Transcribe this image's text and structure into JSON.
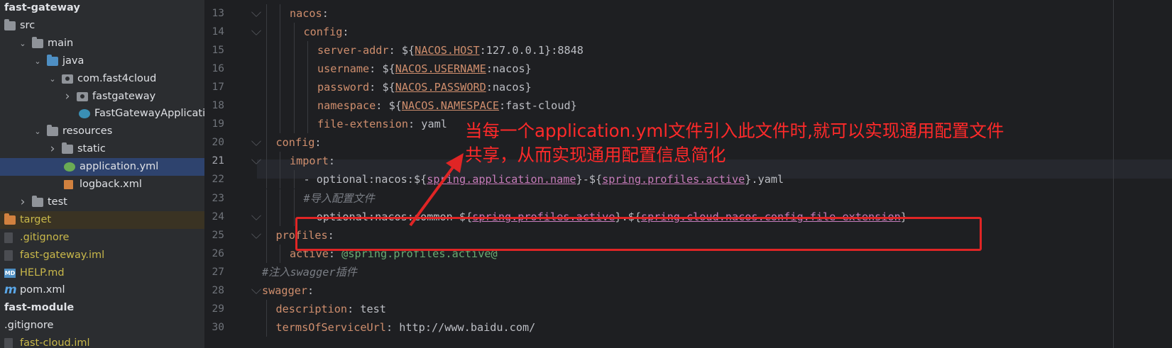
{
  "project_tree": {
    "items": [
      {
        "label": "fast-gateway",
        "depth": 0,
        "kind": "bold"
      },
      {
        "label": "src",
        "depth": 0,
        "kind": "folder"
      },
      {
        "label": "main",
        "depth": 1,
        "kind": "folder",
        "chevron": "down"
      },
      {
        "label": "java",
        "depth": 2,
        "kind": "folder-blue",
        "chevron": "down"
      },
      {
        "label": "com.fast4cloud",
        "depth": 3,
        "kind": "package",
        "chevron": "down"
      },
      {
        "label": "fastgateway",
        "depth": 4,
        "kind": "package",
        "chevron": "right"
      },
      {
        "label": "FastGatewayApplication",
        "depth": 5,
        "kind": "class"
      },
      {
        "label": "resources",
        "depth": 2,
        "kind": "folder-res",
        "chevron": "down"
      },
      {
        "label": "static",
        "depth": 3,
        "kind": "folder",
        "chevron": "right"
      },
      {
        "label": "application.yml",
        "depth": 4,
        "kind": "yml",
        "selected": true
      },
      {
        "label": "logback.xml",
        "depth": 4,
        "kind": "xml"
      },
      {
        "label": "test",
        "depth": 1,
        "kind": "folder",
        "chevron": "right"
      },
      {
        "label": "target",
        "depth": 0,
        "kind": "folder-orange",
        "highlight": true
      },
      {
        "label": ".gitignore",
        "depth": 0,
        "kind": "file-yellow"
      },
      {
        "label": "fast-gateway.iml",
        "depth": 0,
        "kind": "file-yellow"
      },
      {
        "label": "HELP.md",
        "depth": 0,
        "kind": "md"
      },
      {
        "label": "pom.xml",
        "depth": 0,
        "kind": "maven"
      },
      {
        "label": "fast-module",
        "depth": 0,
        "kind": "bold"
      },
      {
        "label": ".gitignore",
        "depth": 0,
        "kind": "plain"
      },
      {
        "label": "fast-cloud.iml",
        "depth": 0,
        "kind": "file-yellow"
      }
    ]
  },
  "editor": {
    "current_line": "21",
    "lines": [
      {
        "n": "13",
        "indent": 2,
        "parts": [
          [
            "k",
            "nacos"
          ],
          [
            "p",
            ":"
          ]
        ]
      },
      {
        "n": "14",
        "indent": 3,
        "parts": [
          [
            "k",
            "config"
          ],
          [
            "p",
            ":"
          ]
        ]
      },
      {
        "n": "15",
        "indent": 4,
        "parts": [
          [
            "k",
            "server-addr"
          ],
          [
            "p",
            ": ${"
          ],
          [
            "u",
            "NACOS.HOST"
          ],
          [
            "p",
            ":127.0.0.1}:8848"
          ]
        ]
      },
      {
        "n": "16",
        "indent": 4,
        "parts": [
          [
            "k",
            "username"
          ],
          [
            "p",
            ": ${"
          ],
          [
            "u",
            "NACOS.USERNAME"
          ],
          [
            "p",
            ":nacos}"
          ]
        ]
      },
      {
        "n": "17",
        "indent": 4,
        "parts": [
          [
            "k",
            "password"
          ],
          [
            "p",
            ": ${"
          ],
          [
            "u",
            "NACOS.PASSWORD"
          ],
          [
            "p",
            ":nacos}"
          ]
        ]
      },
      {
        "n": "18",
        "indent": 4,
        "parts": [
          [
            "k",
            "namespace"
          ],
          [
            "p",
            ": ${"
          ],
          [
            "u",
            "NACOS.NAMESPACE"
          ],
          [
            "p",
            ":fast-cloud}"
          ]
        ]
      },
      {
        "n": "19",
        "indent": 4,
        "parts": [
          [
            "k",
            "file-extension"
          ],
          [
            "p",
            ": yaml"
          ]
        ]
      },
      {
        "n": "20",
        "indent": 1,
        "parts": [
          [
            "k",
            "config"
          ],
          [
            "p",
            ":"
          ]
        ]
      },
      {
        "n": "21",
        "indent": 2,
        "parts": [
          [
            "k",
            "import"
          ],
          [
            "p",
            ":"
          ]
        ]
      },
      {
        "n": "22",
        "indent": 3,
        "parts": [
          [
            "p",
            "- optional:nacos:${"
          ],
          [
            "v",
            "spring.application.name"
          ],
          [
            "p",
            "}-${"
          ],
          [
            "v",
            "spring.profiles.active"
          ],
          [
            "p",
            "}.yaml"
          ]
        ]
      },
      {
        "n": "23",
        "indent": 3,
        "parts": [
          [
            "c",
            "#导入配置文件"
          ]
        ]
      },
      {
        "n": "24",
        "indent": 3,
        "parts": [
          [
            "p",
            "- optional:nacos:common-${"
          ],
          [
            "v",
            "spring.profiles.active"
          ],
          [
            "p",
            "}.${"
          ],
          [
            "v",
            "spring.cloud.nacos.config.file-extension"
          ],
          [
            "p",
            "}"
          ]
        ]
      },
      {
        "n": "25",
        "indent": 1,
        "parts": [
          [
            "k",
            "profiles"
          ],
          [
            "p",
            ":"
          ]
        ]
      },
      {
        "n": "26",
        "indent": 2,
        "parts": [
          [
            "k",
            "active"
          ],
          [
            "p",
            ": "
          ],
          [
            "s",
            "@spring.profiles.active@"
          ]
        ]
      },
      {
        "n": "27",
        "indent": 0,
        "parts": [
          [
            "c",
            "#注入swagger插件"
          ]
        ]
      },
      {
        "n": "28",
        "indent": 0,
        "parts": [
          [
            "k",
            "swagger"
          ],
          [
            "p",
            ":"
          ]
        ]
      },
      {
        "n": "29",
        "indent": 1,
        "parts": [
          [
            "k",
            "description"
          ],
          [
            "p",
            ": test"
          ]
        ]
      },
      {
        "n": "30",
        "indent": 1,
        "parts": [
          [
            "k",
            "termsOfServiceUrl"
          ],
          [
            "p",
            ": http://www.baidu.com/"
          ]
        ]
      }
    ]
  },
  "annotation": {
    "line1": "当每一个application.yml文件引入此文件时,就可以实现通用配置文件",
    "line2": "共享，从而实现通用配置信息简化",
    "color": "#ff2a2a"
  }
}
